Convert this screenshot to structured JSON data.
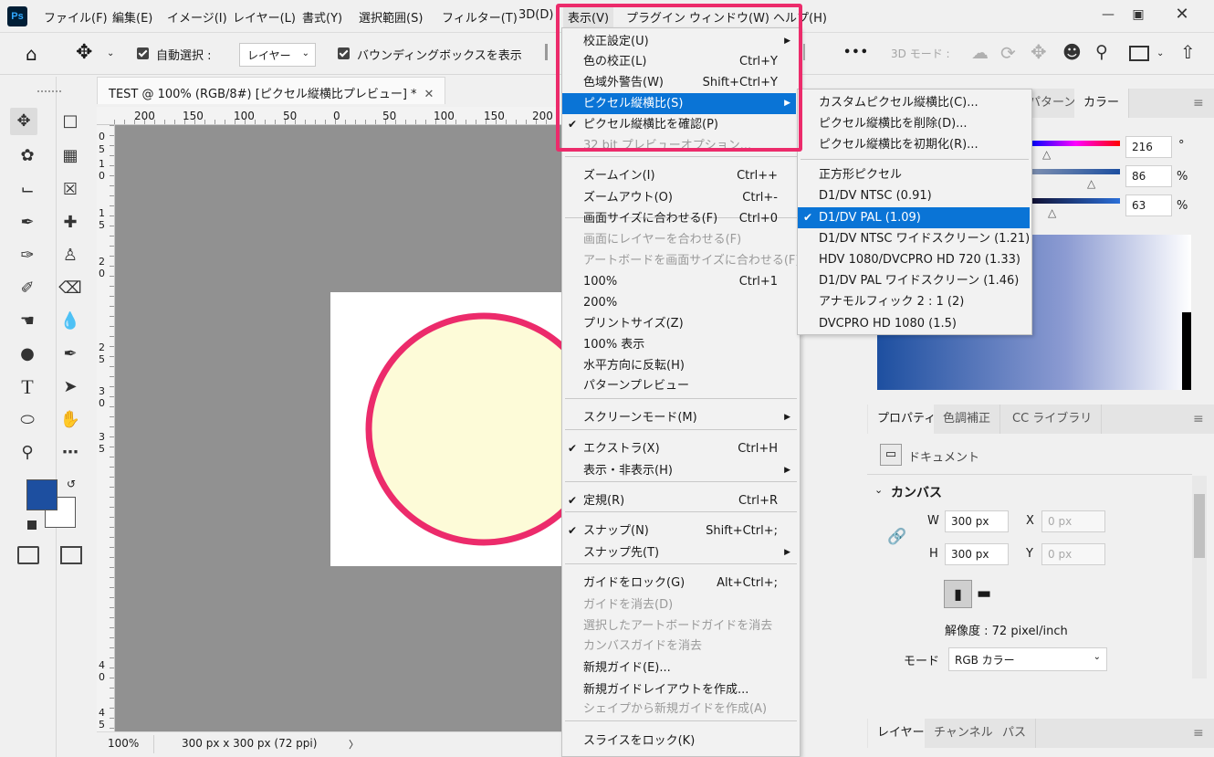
{
  "app_logo": "Ps",
  "menubar": {
    "items": [
      "ファイル(F)",
      "編集(E)",
      "イメージ(I)",
      "レイヤー(L)",
      "書式(Y)",
      "選択範囲(S)",
      "フィルター(T)",
      "3D(D)",
      "表示(V)",
      "プラグイン",
      "ウィンドウ(W)",
      "ヘルプ(H)"
    ],
    "active_index": 8,
    "window_buttons": [
      "minimize",
      "restore",
      "close"
    ]
  },
  "optionsbar": {
    "auto_select_label": "自動選択 :",
    "auto_select_value": "レイヤー",
    "bbox_label": "バウンディングボックスを表示",
    "more_label": "•••",
    "mode3d_label": "3D モード :"
  },
  "document": {
    "tab_title": "TEST @ 100% (RGB/8#) [ピクセル縦横比プレビュー] *",
    "zoom": "100%",
    "size_info": "300 px x 300 px (72 ppi)",
    "ruler_top": [
      "200",
      "150",
      "100",
      "50",
      "0",
      "50",
      "100",
      "150",
      "200"
    ],
    "ruler_left": [
      "0",
      "5",
      "1 0",
      "1 5",
      "2 0",
      "2 5",
      "3 0",
      "3 5",
      "4 0",
      "4 5"
    ],
    "circle_fill": "#fdfbd8",
    "circle_stroke": "#ec2b6b"
  },
  "view_menu": {
    "items": [
      {
        "label": "校正設定(U)",
        "shortcut": "",
        "submenu": true
      },
      {
        "label": "色の校正(L)",
        "shortcut": "Ctrl+Y"
      },
      {
        "label": "色域外警告(W)",
        "shortcut": "Shift+Ctrl+Y"
      },
      {
        "label": "ピクセル縦横比(S)",
        "shortcut": "",
        "submenu": true,
        "highlight": true
      },
      {
        "label": "ピクセル縦横比を確認(P)",
        "shortcut": "",
        "checked": true
      },
      {
        "label": "32 bit プレビューオプション...",
        "shortcut": "",
        "disabled": true
      },
      {
        "label": "ズームイン(I)",
        "shortcut": "Ctrl++"
      },
      {
        "label": "ズームアウト(O)",
        "shortcut": "Ctrl+-"
      },
      {
        "label": "画面サイズに合わせる(F)",
        "shortcut": "Ctrl+0"
      },
      {
        "label": "画面にレイヤーを合わせる(F)",
        "shortcut": "",
        "disabled": true
      },
      {
        "label": "アートボードを画面サイズに合わせる(F)",
        "shortcut": "",
        "disabled": true
      },
      {
        "label": "100%",
        "shortcut": "Ctrl+1"
      },
      {
        "label": "200%",
        "shortcut": ""
      },
      {
        "label": "プリントサイズ(Z)",
        "shortcut": ""
      },
      {
        "label": "100% 表示",
        "shortcut": ""
      },
      {
        "label": "水平方向に反転(H)",
        "shortcut": ""
      },
      {
        "label": "パターンプレビュー",
        "shortcut": ""
      },
      {
        "label": "スクリーンモード(M)",
        "shortcut": "",
        "submenu": true
      },
      {
        "label": "エクストラ(X)",
        "shortcut": "Ctrl+H",
        "checked": true
      },
      {
        "label": "表示・非表示(H)",
        "shortcut": "",
        "submenu": true
      },
      {
        "label": "定規(R)",
        "shortcut": "Ctrl+R",
        "checked": true
      },
      {
        "label": "スナップ(N)",
        "shortcut": "Shift+Ctrl+;",
        "checked": true
      },
      {
        "label": "スナップ先(T)",
        "shortcut": "",
        "submenu": true
      },
      {
        "label": "ガイドをロック(G)",
        "shortcut": "Alt+Ctrl+;"
      },
      {
        "label": "ガイドを消去(D)",
        "shortcut": "",
        "disabled": true
      },
      {
        "label": "選択したアートボードガイドを消去",
        "shortcut": "",
        "disabled": true
      },
      {
        "label": "カンバスガイドを消去",
        "shortcut": "",
        "disabled": true
      },
      {
        "label": "新規ガイド(E)...",
        "shortcut": ""
      },
      {
        "label": "新規ガイドレイアウトを作成...",
        "shortcut": ""
      },
      {
        "label": "シェイプから新規ガイドを作成(A)",
        "shortcut": "",
        "disabled": true
      },
      {
        "label": "スライスをロック(K)",
        "shortcut": ""
      }
    ]
  },
  "pixel_submenu": {
    "items": [
      {
        "label": "カスタムピクセル縦横比(C)..."
      },
      {
        "label": "ピクセル縦横比を削除(D)..."
      },
      {
        "label": "ピクセル縦横比を初期化(R)..."
      },
      {
        "label": "正方形ピクセル"
      },
      {
        "label": "D1/DV NTSC (0.91)"
      },
      {
        "label": "D1/DV PAL (1.09)",
        "checked": true,
        "highlight": true
      },
      {
        "label": "D1/DV NTSC ワイドスクリーン (1.21)"
      },
      {
        "label": "HDV 1080/DVCPRO HD 720 (1.33)"
      },
      {
        "label": "D1/DV PAL ワイドスクリーン (1.46)"
      },
      {
        "label": "アナモルフィック 2 : 1 (2)"
      },
      {
        "label": "DVCPRO HD 1080 (1.5)"
      }
    ]
  },
  "color_panel": {
    "tabs": [
      "パターン",
      "カラー"
    ],
    "h": "216",
    "h_unit": "°",
    "s": "86",
    "s_unit": "%",
    "b": "63",
    "b_unit": "%"
  },
  "properties_panel": {
    "tabs": [
      "プロパティ",
      "色調補正",
      "CC ライブラリ"
    ],
    "doc_label": "ドキュメント",
    "section": "カンバス",
    "w_label": "W",
    "w_value": "300 px",
    "h_label": "H",
    "h_value": "300 px",
    "x_label": "X",
    "x_value": "0 px",
    "y_label": "Y",
    "y_value": "0 px",
    "resolution": "解像度 : 72 pixel/inch",
    "mode_label": "モード",
    "mode_value": "RGB カラー"
  },
  "layers_panel": {
    "tabs": [
      "レイヤー",
      "チャンネル",
      "パス"
    ]
  },
  "colors": {
    "foreground": "#1d4fa0",
    "background": "#ffffff",
    "accent": "#0a74d6",
    "annotation": "#ec2b6b"
  }
}
